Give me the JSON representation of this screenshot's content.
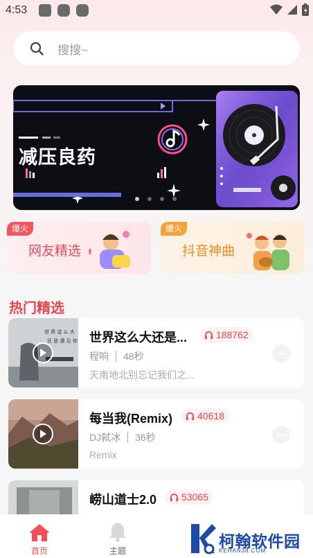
{
  "status_bar": {
    "time": "4:53"
  },
  "search": {
    "placeholder": "搜搜~"
  },
  "banner": {
    "title": "减压良药",
    "dots": 4,
    "active_dot": 0
  },
  "categories": [
    {
      "badge": "爆火",
      "label": "网友精选"
    },
    {
      "badge": "爆火",
      "label": "抖音神曲"
    }
  ],
  "section_title": "热门精选",
  "songs": [
    {
      "title": "世界这么大还是...",
      "count": "188762",
      "artist": "程响",
      "duration": "48秒",
      "desc": "天南地北别忘记我们之..."
    },
    {
      "title": "每当我(Remix)",
      "count": "40618",
      "artist": "DJ弑冰",
      "duration": "36秒",
      "desc": "Remix"
    },
    {
      "title": "崂山道士2.0",
      "count": "53065",
      "artist": "",
      "duration": "",
      "desc": ""
    }
  ],
  "nav": {
    "home": "首页",
    "theme": "主题"
  },
  "watermark": {
    "text": "柯翰软件园",
    "sub": "KEHAN38.COM"
  },
  "colors": {
    "accent": "#e5474f",
    "orange": "#ee8d1e"
  }
}
